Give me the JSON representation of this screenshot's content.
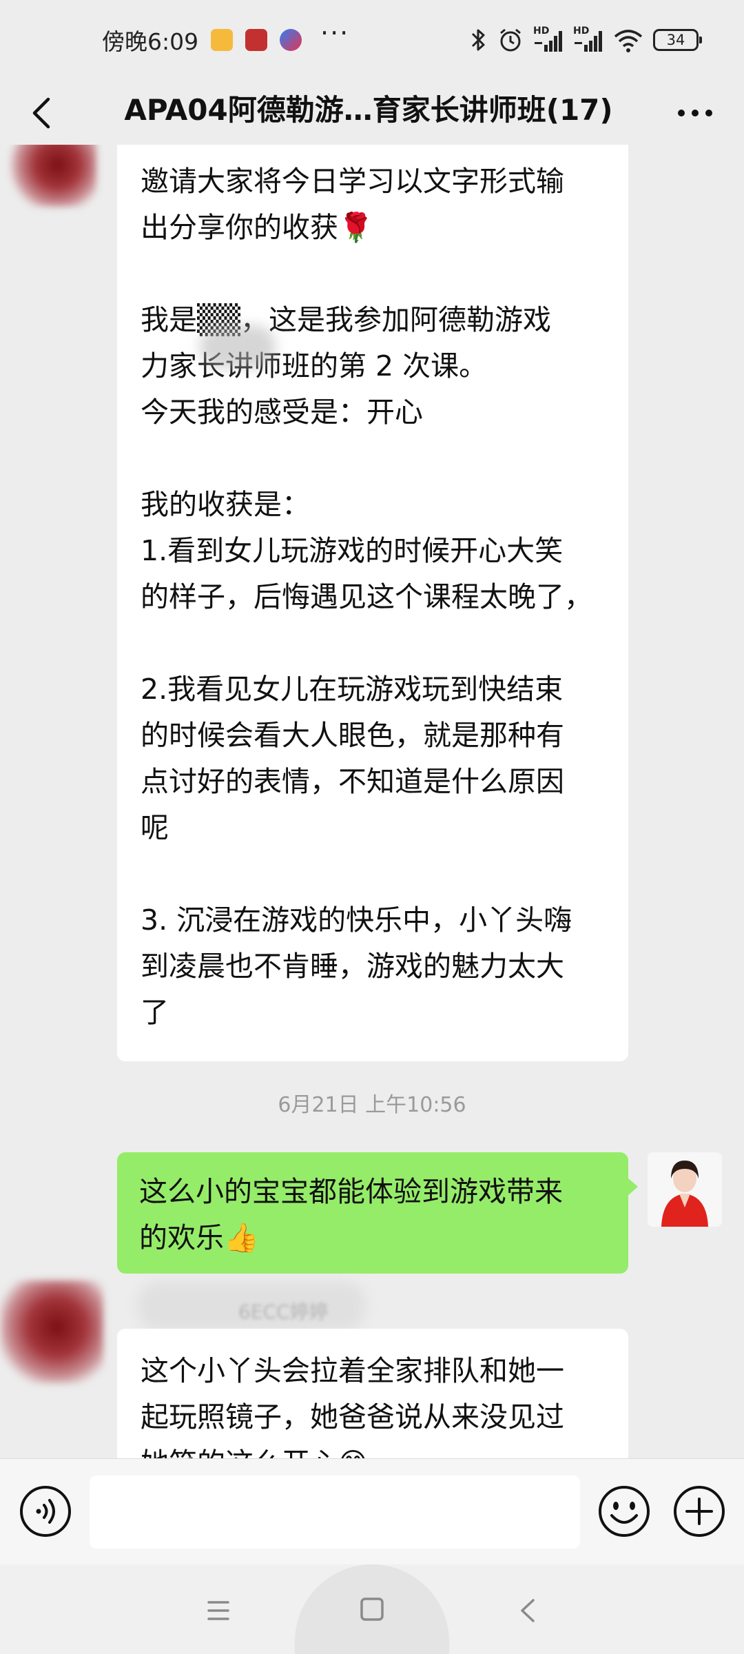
{
  "status_bar": {
    "time": "傍晚6:09",
    "dots": "···",
    "network_1": "HD",
    "network_2": "HD",
    "battery": "34"
  },
  "header": {
    "title": "APA04阿德勒游…育家长讲师班(17)"
  },
  "messages": [
    {
      "side": "left",
      "text": "邀请大家将今日学习以文字形式输\n出分享你的收获🌹\n\n我是▒▒，这是我参加阿德勒游戏\n力家长讲师班的第 2 次课。\n今天我的感受是：开心\n\n我的收获是：\n1.看到女儿玩游戏的时候开心大笑\n的样子，后悔遇见这个课程太晚了，\n\n2.我看见女儿在玩游戏玩到快结束\n的时候会看大人眼色，就是那种有\n点讨好的表情，不知道是什么原因\n呢\n\n3. 沉浸在游戏的快乐中，小丫头嗨\n到凌晨也不肯睡，游戏的魅力太大\n了"
    },
    {
      "side": "right",
      "text": "这么小的宝宝都能体验到游戏带来\n的欢乐👍"
    },
    {
      "side": "left",
      "sender": "6ECC婷婷",
      "text": "这个小丫头会拉着全家排队和她一\n起玩照镜子，她爸爸说从来没见过\n她笑的这么开心😊"
    }
  ],
  "timestamp": "6月21日 上午10:56",
  "input": {
    "value": "",
    "placeholder": ""
  },
  "colors": {
    "background": "#ededed",
    "self_bubble": "#95ec69",
    "other_bubble": "#ffffff"
  }
}
